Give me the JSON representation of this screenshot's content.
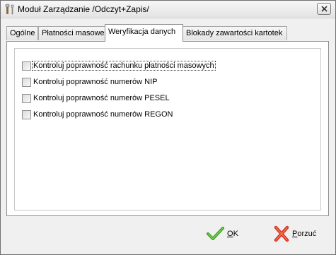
{
  "window": {
    "title": "Moduł Zarządzanie /Odczyt+Zapis/"
  },
  "tabs": [
    {
      "label": "Ogólne",
      "active": false
    },
    {
      "label": "Płatności masowe",
      "active": false
    },
    {
      "label": "Weryfikacja danych",
      "active": true
    },
    {
      "label": "Blokady zawartości kartotek",
      "active": false
    }
  ],
  "verification": {
    "options": [
      {
        "label": "Kontroluj poprawność rachunku płatności masowych",
        "checked": false
      },
      {
        "label": "Kontroluj poprawność numerów NIP",
        "checked": false
      },
      {
        "label": "Kontroluj poprawność numerów PESEL",
        "checked": false
      },
      {
        "label": "Kontroluj poprawność numerów REGON",
        "checked": false
      }
    ]
  },
  "buttons": {
    "ok_label": "OK",
    "ok_mnemonic": "O",
    "ok_rest": "K",
    "cancel_label": "Porzuć",
    "cancel_mnemonic": "P",
    "cancel_rest": "orzuć"
  },
  "colors": {
    "ok_icon": "#3a9a1f",
    "cancel_icon": "#d9301c",
    "panel_background": "#ffffff",
    "window_background": "#f0f0f0"
  },
  "icons": {
    "app": "wrench-tools-icon",
    "close": "close-icon",
    "ok": "checkmark-icon",
    "cancel": "red-x-icon"
  }
}
